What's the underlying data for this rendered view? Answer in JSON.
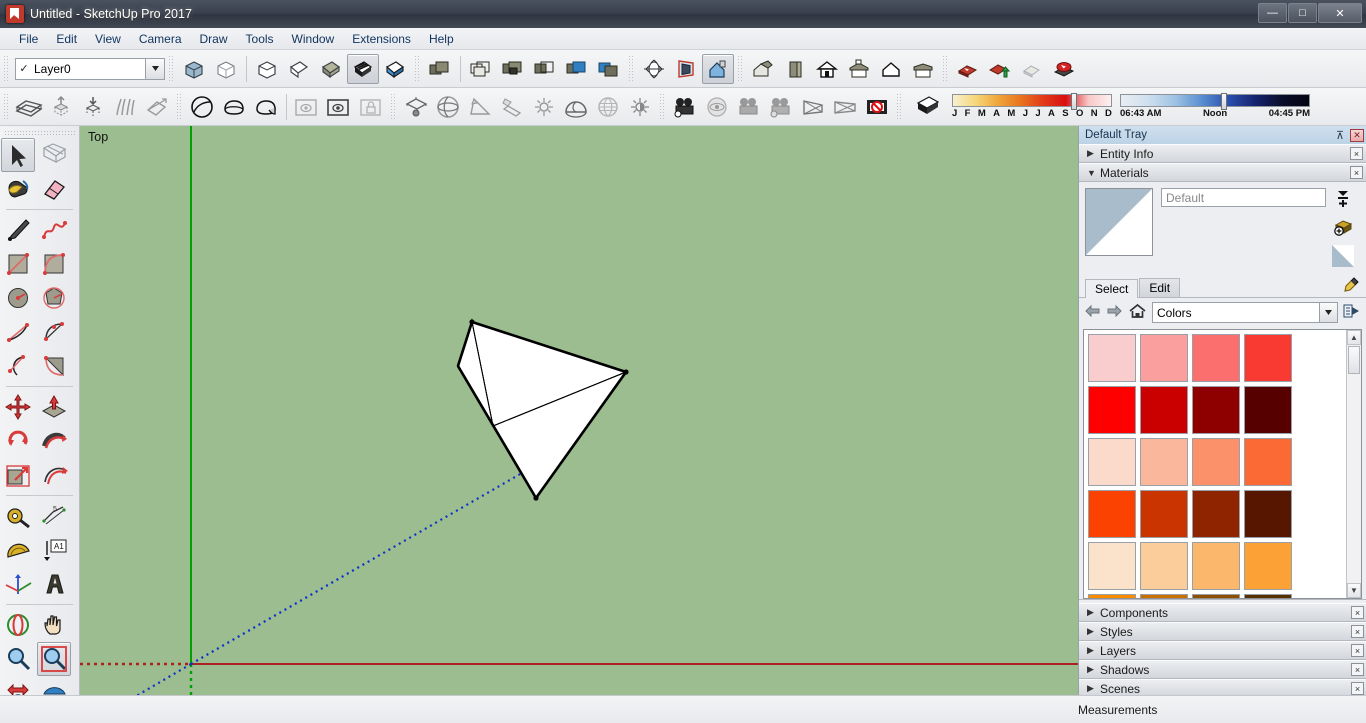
{
  "window": {
    "title": "Untitled - SketchUp Pro 2017",
    "app_icon": "sketchup-logo-icon",
    "controls": {
      "minimize": "—",
      "maximize": "□",
      "close": "✕"
    }
  },
  "menu": {
    "items": [
      "File",
      "Edit",
      "View",
      "Camera",
      "Draw",
      "Tools",
      "Window",
      "Extensions",
      "Help"
    ]
  },
  "layer_selector": {
    "checkmark": "✓",
    "value": "Layer0",
    "arrow": "▼"
  },
  "toolbar_row1": {
    "style_tools": [
      "xray-icon",
      "wireframe-icon",
      "hidden-line-icon",
      "shaded-icon",
      "shaded-texture-icon",
      "monochrome-icon",
      "back-edges-icon"
    ],
    "section_tools": [
      "section-plane-icon",
      "display-section-planes-icon",
      "display-section-cuts-icon",
      "display-section-fill-icon",
      "solid-union-icon",
      "solid-subtract-icon"
    ],
    "camera_tools": [
      "standard-views-icon",
      "perspective-icon",
      "parallel-projection-icon"
    ],
    "view_tools": [
      "iso-view-icon",
      "front-view-icon",
      "top-view-icon",
      "right-view-icon",
      "back-view-icon",
      "left-view-icon"
    ],
    "warehouse_tools": [
      "3d-warehouse-icon",
      "share-model-icon",
      "extension-warehouse-icon",
      "component-warehouse-icon"
    ]
  },
  "toolbar_row2": {
    "sandbox_tools": [
      "from-contours-icon",
      "from-scratch-icon",
      "smoove-icon",
      "stamp-icon",
      "drape-icon"
    ],
    "solid_tools": [
      "outer-shell-icon",
      "intersect-icon",
      "union-icon"
    ],
    "warehouse2": [
      "photo-texture-icon",
      "match-photo-icon",
      "lock-icon"
    ],
    "advanced_camera": [
      "create-camera-icon",
      "look-through-icon",
      "lock-camera-icon",
      "show-frustum-icon",
      "aspect-ratio-icon",
      "safe-frame-icon",
      "reset-camera-icon"
    ],
    "misc": [
      "dynamic-components-icon",
      "interact-icon",
      "component-options-icon"
    ]
  },
  "shadow_bar": {
    "eraser_icon": "shadow-settings-icon",
    "month_labels": [
      "J",
      "F",
      "M",
      "A",
      "M",
      "J",
      "J",
      "A",
      "S",
      "O",
      "N",
      "D"
    ],
    "time_start": "06:43 AM",
    "time_noon": "Noon",
    "time_end": "04:45 PM"
  },
  "left_toolbar": {
    "groups": [
      {
        "tools": [
          {
            "name": "select-tool",
            "active": true
          },
          {
            "name": "lasso-select-tool",
            "active": false
          },
          {
            "name": "paint-bucket-tool",
            "active": false
          },
          {
            "name": "eraser-tool",
            "active": false
          }
        ]
      },
      {
        "tools": [
          {
            "name": "line-tool",
            "active": false
          },
          {
            "name": "freehand-tool",
            "active": false
          },
          {
            "name": "rectangle-tool",
            "active": false
          },
          {
            "name": "rotated-rectangle-tool",
            "active": false
          },
          {
            "name": "circle-tool",
            "active": false
          },
          {
            "name": "polygon-tool",
            "active": false
          },
          {
            "name": "arc-tool",
            "active": false
          },
          {
            "name": "two-point-arc-tool",
            "active": false
          },
          {
            "name": "three-point-arc-tool",
            "active": false
          },
          {
            "name": "pie-tool",
            "active": false
          }
        ]
      },
      {
        "tools": [
          {
            "name": "move-tool",
            "active": false
          },
          {
            "name": "push-pull-tool",
            "active": false
          },
          {
            "name": "rotate-tool",
            "active": false
          },
          {
            "name": "follow-me-tool",
            "active": false
          },
          {
            "name": "scale-tool",
            "active": false
          },
          {
            "name": "offset-tool",
            "active": false
          }
        ]
      },
      {
        "tools": [
          {
            "name": "tape-measure-tool",
            "active": false
          },
          {
            "name": "dimension-tool",
            "active": false
          },
          {
            "name": "protractor-tool",
            "active": false
          },
          {
            "name": "text-tool",
            "active": false
          },
          {
            "name": "axes-tool",
            "active": false
          },
          {
            "name": "three-d-text-tool",
            "active": false
          }
        ]
      },
      {
        "tools": [
          {
            "name": "orbit-tool",
            "active": false
          },
          {
            "name": "pan-tool",
            "active": false
          },
          {
            "name": "zoom-tool",
            "active": false
          },
          {
            "name": "zoom-window-tool",
            "active": true
          },
          {
            "name": "zoom-extents-tool",
            "active": false
          },
          {
            "name": "previous-view-tool",
            "active": false
          }
        ]
      }
    ]
  },
  "viewport": {
    "label": "Top",
    "background_color": "#9cbd90",
    "axis_x_color": "#aa2222",
    "axis_y_color": "#00a000",
    "axis_z_color": "#1030c8",
    "model": "tetrahedron-pyramid",
    "model_fill": "#ffffff",
    "model_stroke": "#000000"
  },
  "tray": {
    "title": "Default Tray",
    "pin_icon": "pin-icon",
    "close_icon": "close-icon",
    "panels_top": [
      {
        "label": "Entity Info",
        "expanded": false,
        "triangle": "▶",
        "close": "×"
      },
      {
        "label": "Materials",
        "expanded": true,
        "triangle": "▼",
        "close": "×"
      }
    ],
    "materials": {
      "swatch_name": "default-material-swatch",
      "name_value": "Default",
      "icons": [
        "sample-paint-icon",
        "create-material-icon",
        "default-material-icon"
      ],
      "eyedropper_icon": "eyedropper-icon",
      "details_icon": "details-arrow-icon",
      "tabs": [
        {
          "label": "Select",
          "selected": true
        },
        {
          "label": "Edit",
          "selected": false
        }
      ],
      "nav": {
        "back_icon": "back-arrow-icon",
        "forward_icon": "forward-arrow-icon",
        "home_icon": "home-icon"
      },
      "library": {
        "value": "Colors",
        "arrow": "▼"
      },
      "scrollbar": {
        "up": "▲",
        "down": "▼"
      },
      "colors": [
        "#f9cdcd",
        "#fb9e9e",
        "#fb6f6f",
        "#f93a33",
        "#fe0000",
        "#ca0000",
        "#8e0000",
        "#560000",
        "#fbd9cb",
        "#fbb79b",
        "#fb916b",
        "#fb6a35",
        "#fb4200",
        "#ca3400",
        "#8e2500",
        "#561600",
        "#fbe3cb",
        "#fbcd9b",
        "#fbb76b",
        "#fba135",
        "#fb8c00",
        "#c97000",
        "#8d4f00",
        "#553000"
      ]
    },
    "panels_bottom": [
      {
        "label": "Components",
        "triangle": "▶",
        "close": "×"
      },
      {
        "label": "Styles",
        "triangle": "▶",
        "close": "×"
      },
      {
        "label": "Layers",
        "triangle": "▶",
        "close": "×"
      },
      {
        "label": "Shadows",
        "triangle": "▶",
        "close": "×"
      },
      {
        "label": "Scenes",
        "triangle": "▶",
        "close": "×"
      }
    ]
  },
  "status_bar": {
    "measurements_label": "Measurements"
  }
}
